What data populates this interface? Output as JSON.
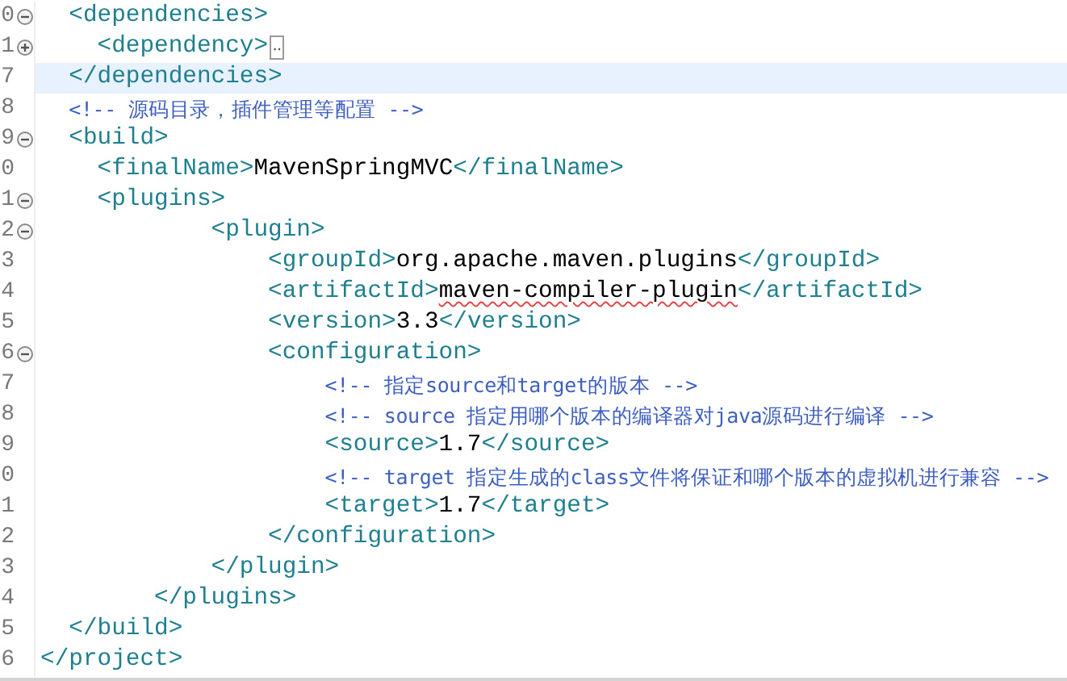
{
  "editor": {
    "lines": [
      {
        "number": "0",
        "expanded": true,
        "current": false,
        "tokens": [
          {
            "kind": "tag",
            "text": "  <dependencies>"
          }
        ]
      },
      {
        "number": "1",
        "expanded": false,
        "current": false,
        "tokens": [
          {
            "kind": "tag",
            "text": "    <dependency>"
          },
          {
            "kind": "folded",
            "text": "‥"
          }
        ]
      },
      {
        "number": "7",
        "current": true,
        "tokens": [
          {
            "kind": "tag",
            "text": "  </dependencies>"
          }
        ]
      },
      {
        "number": "8",
        "current": false,
        "tokens": [
          {
            "kind": "comment",
            "text": "  <!-- 源码目录，插件管理等配置 -->"
          }
        ]
      },
      {
        "number": "9",
        "expanded": true,
        "current": false,
        "tokens": [
          {
            "kind": "tag",
            "text": "  <build>"
          }
        ]
      },
      {
        "number": "0",
        "current": false,
        "tokens": [
          {
            "kind": "tag",
            "text": "    <finalName>"
          },
          {
            "kind": "text",
            "text": "MavenSpringMVC"
          },
          {
            "kind": "tag",
            "text": "</finalName>"
          }
        ]
      },
      {
        "number": "1",
        "expanded": true,
        "current": false,
        "tokens": [
          {
            "kind": "tag",
            "text": "    <plugins>"
          }
        ]
      },
      {
        "number": "2",
        "expanded": true,
        "current": false,
        "tokens": [
          {
            "kind": "tag",
            "text": "            <plugin>"
          }
        ]
      },
      {
        "number": "3",
        "current": false,
        "tokens": [
          {
            "kind": "tag",
            "text": "                <groupId>"
          },
          {
            "kind": "text",
            "text": "org.apache.maven.plugins"
          },
          {
            "kind": "tag",
            "text": "</groupId>"
          }
        ]
      },
      {
        "number": "4",
        "current": false,
        "tokens": [
          {
            "kind": "tag",
            "text": "                <artifactId>"
          },
          {
            "kind": "misspelled",
            "text": "maven-compiler-plugin"
          },
          {
            "kind": "tag",
            "text": "</artifactId>"
          }
        ]
      },
      {
        "number": "5",
        "current": false,
        "tokens": [
          {
            "kind": "tag",
            "text": "                <version>"
          },
          {
            "kind": "text",
            "text": "3.3"
          },
          {
            "kind": "tag",
            "text": "</version>"
          }
        ]
      },
      {
        "number": "6",
        "expanded": true,
        "current": false,
        "tokens": [
          {
            "kind": "tag",
            "text": "                <configuration>"
          }
        ]
      },
      {
        "number": "7",
        "current": false,
        "tokens": [
          {
            "kind": "comment",
            "text": "                    <!-- 指定source和target的版本 -->"
          }
        ]
      },
      {
        "number": "8",
        "current": false,
        "tokens": [
          {
            "kind": "comment",
            "text": "                    <!-- source 指定用哪个版本的编译器对java源码进行编译 -->"
          }
        ]
      },
      {
        "number": "9",
        "current": false,
        "tokens": [
          {
            "kind": "tag",
            "text": "                    <source>"
          },
          {
            "kind": "text",
            "text": "1.7"
          },
          {
            "kind": "tag",
            "text": "</source>"
          }
        ]
      },
      {
        "number": "0",
        "current": false,
        "tokens": [
          {
            "kind": "comment",
            "text": "                    <!-- target 指定生成的class文件将保证和哪个版本的虚拟机进行兼容 -->"
          }
        ]
      },
      {
        "number": "1",
        "current": false,
        "tokens": [
          {
            "kind": "tag",
            "text": "                    <target>"
          },
          {
            "kind": "text",
            "text": "1.7"
          },
          {
            "kind": "tag",
            "text": "</target>"
          }
        ]
      },
      {
        "number": "2",
        "current": false,
        "tokens": [
          {
            "kind": "tag",
            "text": "                </configuration>"
          }
        ]
      },
      {
        "number": "3",
        "current": false,
        "tokens": [
          {
            "kind": "tag",
            "text": "            </plugin>"
          }
        ]
      },
      {
        "number": "4",
        "current": false,
        "tokens": [
          {
            "kind": "tag",
            "text": "        </plugins>"
          }
        ]
      },
      {
        "number": "5",
        "current": false,
        "tokens": [
          {
            "kind": "tag",
            "text": "  </build>"
          }
        ]
      },
      {
        "number": "6",
        "current": false,
        "tokens": [
          {
            "kind": "tag",
            "text": "</project>"
          }
        ]
      }
    ]
  }
}
